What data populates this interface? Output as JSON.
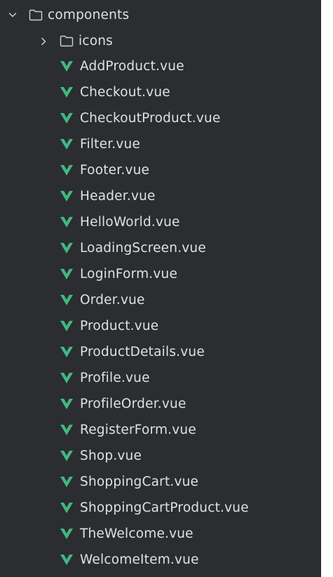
{
  "tree": {
    "root": {
      "label": "components",
      "icon": "folder-icon",
      "expanded": true
    },
    "subfolder": {
      "label": "icons",
      "icon": "folder-icon",
      "expanded": false
    },
    "files": [
      "AddProduct.vue",
      "Checkout.vue",
      "CheckoutProduct.vue",
      "Filter.vue",
      "Footer.vue",
      "Header.vue",
      "HelloWorld.vue",
      "LoadingScreen.vue",
      "LoginForm.vue",
      "Order.vue",
      "Product.vue",
      "ProductDetails.vue",
      "Profile.vue",
      "ProfileOrder.vue",
      "RegisterForm.vue",
      "Shop.vue",
      "ShoppingCart.vue",
      "ShoppingCartProduct.vue",
      "TheWelcome.vue",
      "WelcomeItem.vue"
    ],
    "file_icon": "vue-icon"
  },
  "colors": {
    "background": "#2b2d30",
    "text": "#dfe1e5",
    "vue_green": "#41b883",
    "icon_gray": "#ced0d6"
  }
}
